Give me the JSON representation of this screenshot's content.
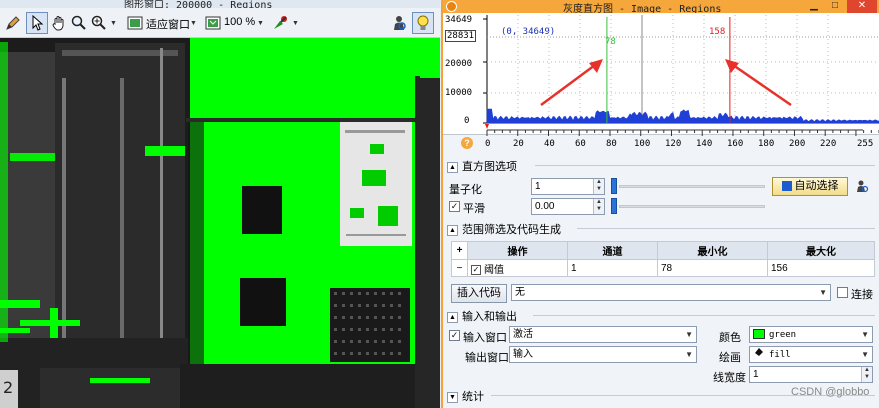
{
  "left_window": {
    "title": "图形窗口: 200000 - Regions",
    "toolbar": {
      "fit_label": "适应窗口",
      "zoom_label": "100 %"
    }
  },
  "right_window": {
    "title": "灰度直方图 - Image - Regions",
    "histogram": {
      "y_ticks": [
        "34649",
        "28831",
        "20000",
        "10000",
        "0"
      ],
      "cursor_readout": "(0, 34649)",
      "x_ticks": [
        "0",
        "20",
        "40",
        "60",
        "80",
        "100",
        "120",
        "140",
        "160",
        "180",
        "200",
        "220",
        "255"
      ],
      "min_marker": "78",
      "max_marker": "158"
    },
    "options_section": {
      "title": "直方图选项",
      "quantize_label": "量子化",
      "quantize_value": "1",
      "auto_select_label": "自动选择",
      "smooth_label": "平滑",
      "smooth_value": "0.00"
    },
    "range_section": {
      "title": "范围筛选及代码生成",
      "columns": [
        "操作",
        "通道",
        "最小化",
        "最大化"
      ],
      "rows": [
        {
          "operation": "阈值",
          "channel": "1",
          "min": "78",
          "max": "156"
        }
      ],
      "insert_code_label": "插入代码",
      "insert_code_value": "无",
      "connect_label": "连接"
    },
    "io_section": {
      "title": "输入和输出",
      "input_window_label": "输入窗口",
      "input_window_value": "激活",
      "output_window_label": "输出窗口",
      "output_window_value": "输入",
      "color_label": "颜色",
      "color_value": "green",
      "draw_label": "绘画",
      "draw_value": "fill",
      "line_width_label": "线宽度",
      "line_width_value": "1"
    },
    "stats_section": {
      "title": "统计"
    }
  },
  "watermark": "CSDN @globbo",
  "colors": {
    "region_green": "#00ff00",
    "min_line": "#36c03e",
    "max_line": "#e41b1b",
    "arrow_red": "#e8312b",
    "histogram_fill": "#1f3fd6",
    "title_orange": "#f6a73b"
  }
}
